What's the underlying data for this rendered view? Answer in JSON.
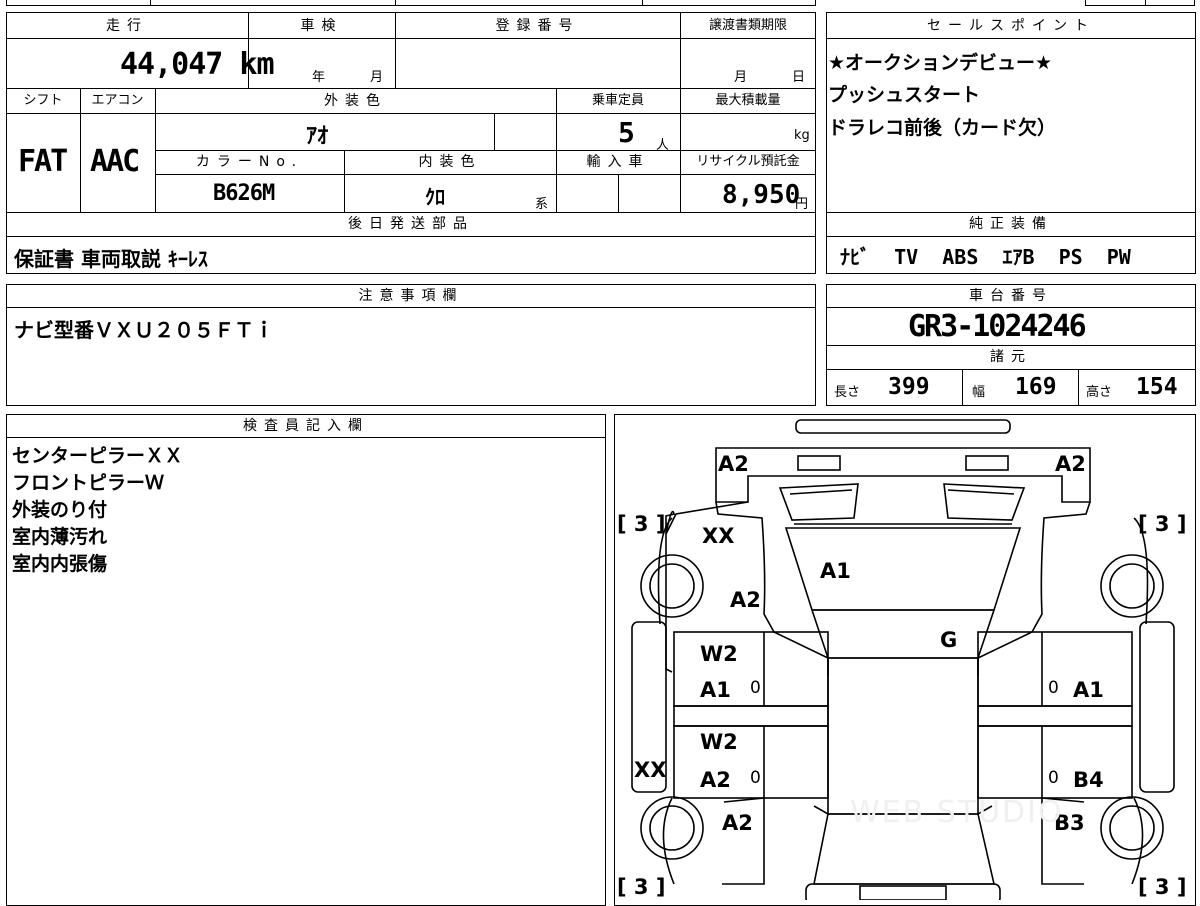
{
  "headers": {
    "mileage": "走行",
    "inspection": "車検",
    "registration": "登録番号",
    "transfer_deadline": "譲渡書類期限",
    "shift": "シフト",
    "aircon": "エアコン",
    "exterior_color": "外装色",
    "capacity": "乗車定員",
    "max_load": "最大積載量",
    "color_no": "カラーNo.",
    "interior_color": "内装色",
    "import": "輸入車",
    "recycle": "リサイクル預託金",
    "later_parts": "後日発送部品",
    "sales_points": "セールスポイント",
    "genuine_equipment": "純正装備",
    "notes": "注意事項欄",
    "chassis_no": "車台番号",
    "specs": "諸元",
    "inspector": "検査員記入欄"
  },
  "vehicle": {
    "mileage": "44,047 km",
    "inspection_year_unit": "年",
    "inspection_month_unit": "月",
    "deadline_month_unit": "月",
    "deadline_day_unit": "日",
    "shift": "FAT",
    "aircon": "AAC",
    "exterior_color": "ｱｵ",
    "capacity": "5",
    "capacity_unit": "人",
    "max_load_unit": "kg",
    "color_no": "B626M",
    "interior_color": "ｸﾛ",
    "interior_color_suffix": "系",
    "recycle_fee": "8,950",
    "recycle_unit": "円",
    "later_parts": "保証書 車両取説 ｷｰﾚｽ",
    "chassis_no": "GR3-1024246"
  },
  "sales_points": [
    "★オークションデビュー★",
    "プッシュスタート",
    "ドラレコ前後（カード欠）"
  ],
  "equipment": "ﾅﾋﾞ  TV  ABS  ｴｱB  PS  PW",
  "notes": "ナビ型番ＶＸＵ２０５ＦＴｉ",
  "specs": {
    "length_label": "長さ",
    "length": "399",
    "width_label": "幅",
    "width": "169",
    "height_label": "高さ",
    "height": "154"
  },
  "inspector_notes": [
    "センターピラーＸＸ",
    "フロントピラーＷ",
    "外装のり付",
    "室内薄汚れ",
    "室内内張傷"
  ],
  "diagram": {
    "marks": {
      "front_left": "A2",
      "front_right": "A2",
      "tire_fl": "[ 3 ]",
      "tire_fr": "[ 3 ]",
      "tire_rl": "[ 3 ]",
      "tire_rr": "[ 3 ]",
      "pillar_front": "XX",
      "hood": "A1",
      "fender_left": "A2",
      "glass": "G",
      "door_fl_1": "W2",
      "door_fl_2": "A1",
      "door_fr": "A1",
      "door_rl_1": "W2",
      "door_rl_2": "A2",
      "door_rr": "B4",
      "side_left": "XX",
      "rear_left": "A2",
      "rear_right": "B3",
      "zero_1": "0",
      "zero_2": "0",
      "zero_3": "0",
      "zero_4": "0"
    },
    "watermark": "WEB STUDIO"
  }
}
